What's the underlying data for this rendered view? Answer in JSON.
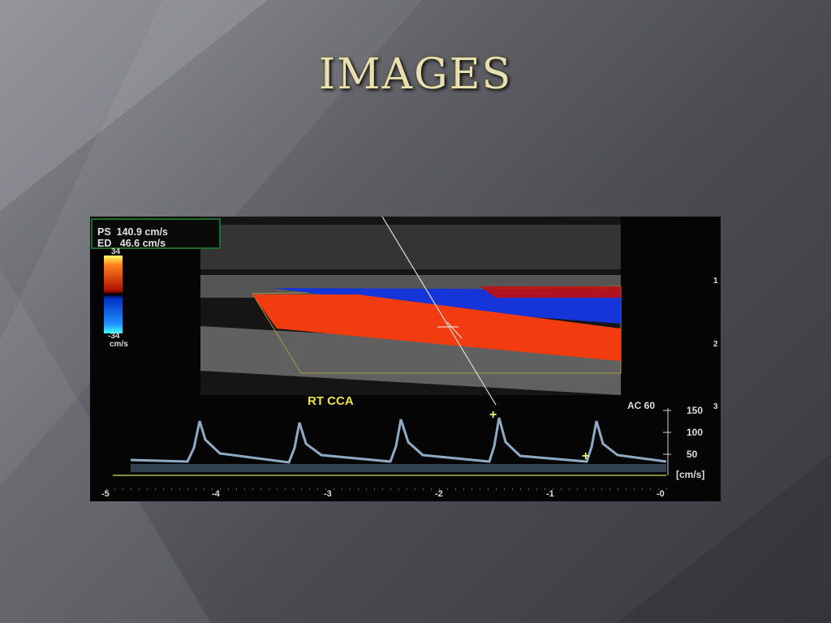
{
  "slide": {
    "title": "IMAGES"
  },
  "ultrasound": {
    "readout": {
      "ps": "PS  140.9 cm/s",
      "ed": "ED   46.6 cm/s"
    },
    "color_scale": {
      "top": "34",
      "bottom": "-34",
      "unit": "cm/s"
    },
    "vessel_label": "RT CCA",
    "ac_label": "AC 60",
    "velocity_ticks": [
      "150",
      "100",
      "50"
    ],
    "velocity_unit": "[cm/s]",
    "time_ticks": [
      "-5",
      "-4",
      "-3",
      "-2",
      "-1",
      "-0"
    ],
    "depth_ticks": [
      "1",
      "2",
      "3"
    ]
  }
}
